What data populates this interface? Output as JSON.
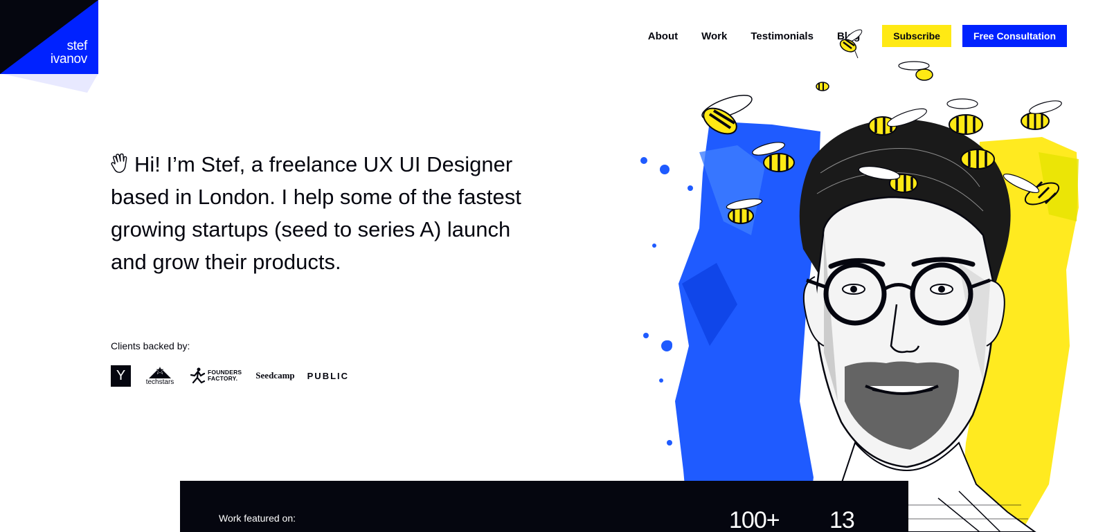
{
  "logo": {
    "line1": "stef",
    "line2": "ivanov",
    "colors": {
      "dark": "#05060f",
      "blue": "#0022ff",
      "shadow": "#e8e9ff"
    }
  },
  "nav": {
    "links": [
      "About",
      "Work",
      "Testimonials",
      "Blog"
    ],
    "subscribe": "Subscribe",
    "consultation": "Free Consultation"
  },
  "hero": {
    "text": "Hi! I’m Stef, a freelance UX UI Designer based in London. I help some of the fastest growing startups (seed to series A) launch and grow their products.",
    "icon": "waving-hand-icon"
  },
  "clients": {
    "label": "Clients backed by:",
    "logos": {
      "yc": "Y",
      "techstars": "techstars",
      "founders_factory_line1": "FOUNDERS",
      "founders_factory_line2": "FACTORY.",
      "seedcamp": "Seedcamp",
      "public": "PUBLIC"
    }
  },
  "band": {
    "label": "Work featured on:",
    "stat1": "100+",
    "stat2": "13"
  },
  "colors": {
    "accent_blue": "#0022ff",
    "accent_yellow": "#ffe914",
    "dark": "#05060f"
  }
}
